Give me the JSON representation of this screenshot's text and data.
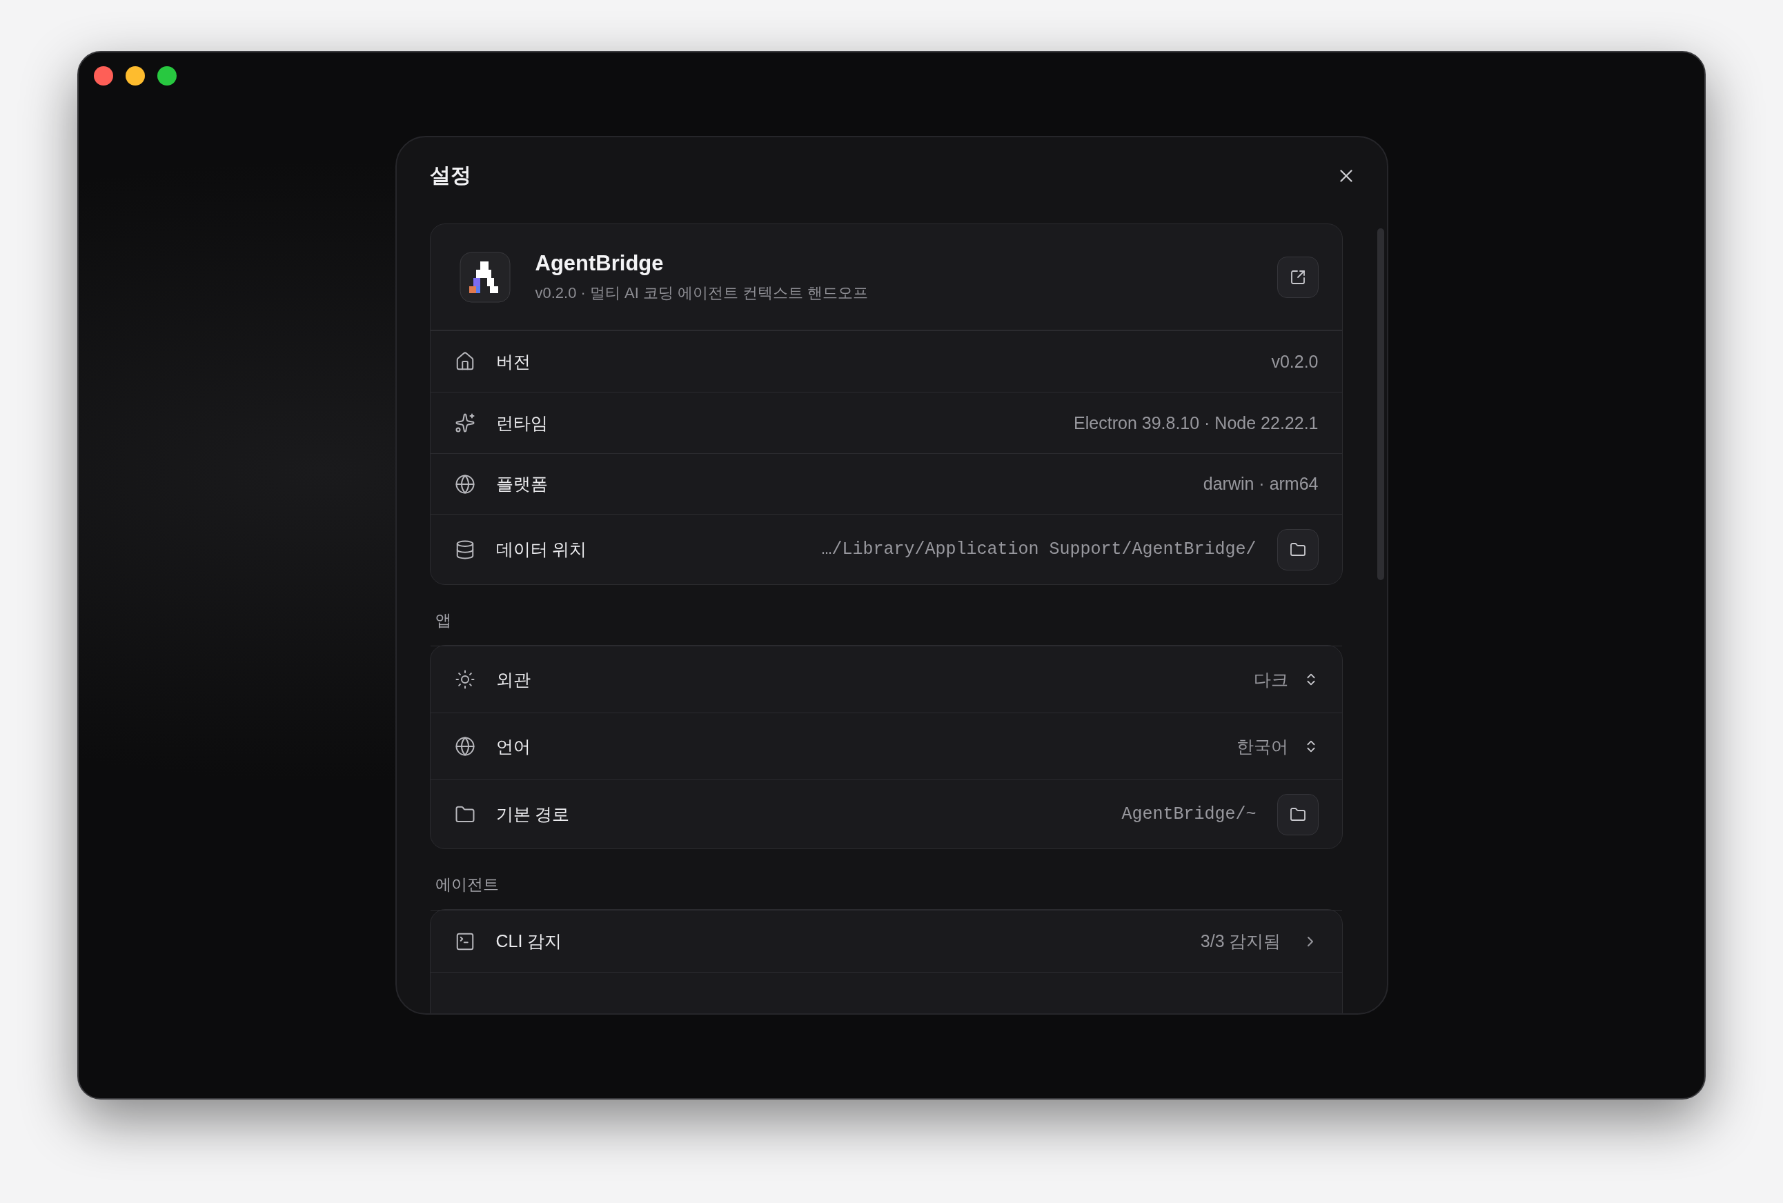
{
  "dialog": {
    "title": "설정"
  },
  "app_card": {
    "name": "AgentBridge",
    "subtitle": "v0.2.0 · 멀티 AI 코딩 에이전트 컨텍스트 핸드오프"
  },
  "info_rows": [
    {
      "kind": "text",
      "label": "버전",
      "value": "v0.2.0"
    },
    {
      "kind": "text",
      "label": "런타임",
      "value": "Electron 39.8.10 · Node 22.22.1"
    },
    {
      "kind": "text",
      "label": "플랫폼",
      "value": "darwin · arm64"
    },
    {
      "kind": "path",
      "label": "데이터 위치",
      "value": "…/Library/Application Support/AgentBridge/"
    }
  ],
  "sections": [
    {
      "title": "앱",
      "rows": [
        {
          "kind": "select",
          "label": "외관",
          "value": "다크"
        },
        {
          "kind": "select",
          "label": "언어",
          "value": "한국어"
        },
        {
          "kind": "path",
          "label": "기본 경로",
          "value": "AgentBridge/~"
        }
      ]
    },
    {
      "title": "에이전트",
      "rows": [
        {
          "kind": "link",
          "label": "CLI 감지",
          "value": "3/3 감지됨"
        },
        {
          "kind": "cut"
        }
      ]
    }
  ]
}
